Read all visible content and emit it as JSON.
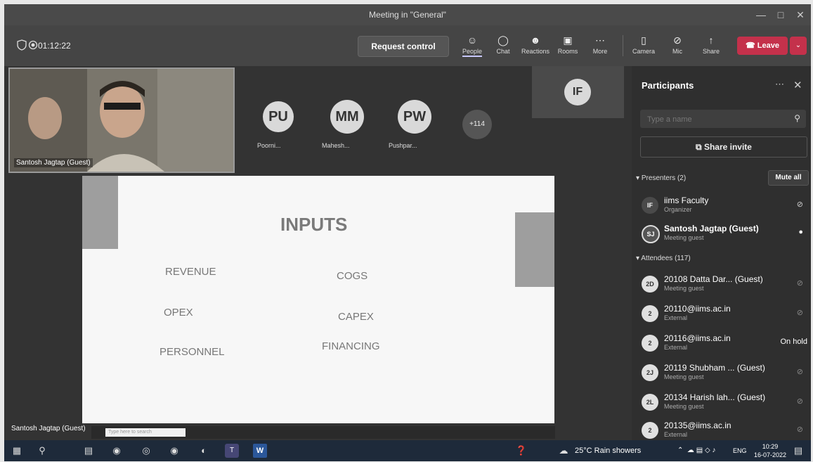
{
  "window": {
    "title": "Meeting in \"General\""
  },
  "toolbar": {
    "timer": "01:12:22",
    "request_control": "Request control",
    "tools": [
      {
        "label": "People",
        "icon": "people-icon"
      },
      {
        "label": "Chat",
        "icon": "chat-icon"
      },
      {
        "label": "Reactions",
        "icon": "reactions-icon"
      },
      {
        "label": "Rooms",
        "icon": "rooms-icon"
      },
      {
        "label": "More",
        "icon": "more-icon"
      }
    ],
    "controls": [
      {
        "label": "Camera",
        "icon": "camera-off-icon"
      },
      {
        "label": "Mic",
        "icon": "mic-off-icon"
      },
      {
        "label": "Share",
        "icon": "share-icon"
      }
    ],
    "leave": "Leave"
  },
  "stage": {
    "video_name": "Santosh Jagtap (Guest)",
    "avatars": [
      {
        "initials": "PU",
        "name": "Poorni..."
      },
      {
        "initials": "MM",
        "name": "Mahesh..."
      },
      {
        "initials": "PW",
        "name": "Pushpar..."
      }
    ],
    "overflow": "+114",
    "featured_initials": "IF",
    "bottom_name": "Santosh Jagtap (Guest)",
    "inner_search": "Type here to search"
  },
  "slide": {
    "title": "INPUTS",
    "items": [
      "REVENUE",
      "COGS",
      "OPEX",
      "CAPEX",
      "PERSONNEL",
      "FINANCING"
    ]
  },
  "panel": {
    "title": "Participants",
    "search_placeholder": "Type a name",
    "share_invite": "Share invite",
    "presenters_header": "Presenters (2)",
    "mute_all": "Mute all",
    "attendees_header": "Attendees (117)",
    "presenters": [
      {
        "initials": "IF",
        "name": "iims Faculty",
        "role": "Organizer"
      },
      {
        "initials": "SJ",
        "name": "Santosh Jagtap (Guest)",
        "role": "Meeting guest"
      }
    ],
    "attendees": [
      {
        "initials": "2D",
        "name": "20108 Datta Dar... (Guest)",
        "role": "Meeting guest",
        "status": ""
      },
      {
        "initials": "2",
        "name": "20110@iims.ac.in",
        "role": "External",
        "status": ""
      },
      {
        "initials": "2",
        "name": "20116@iims.ac.in",
        "role": "External",
        "status": "On hold"
      },
      {
        "initials": "2J",
        "name": "20119 Shubham ... (Guest)",
        "role": "Meeting guest",
        "status": ""
      },
      {
        "initials": "2L",
        "name": "20134 Harish lah... (Guest)",
        "role": "Meeting guest",
        "status": ""
      },
      {
        "initials": "2",
        "name": "20135@iims.ac.in",
        "role": "External",
        "status": ""
      }
    ]
  },
  "taskbar": {
    "weather": "25°C Rain showers",
    "lang": "ENG",
    "time": "10:29",
    "date": "16-07-2022"
  }
}
